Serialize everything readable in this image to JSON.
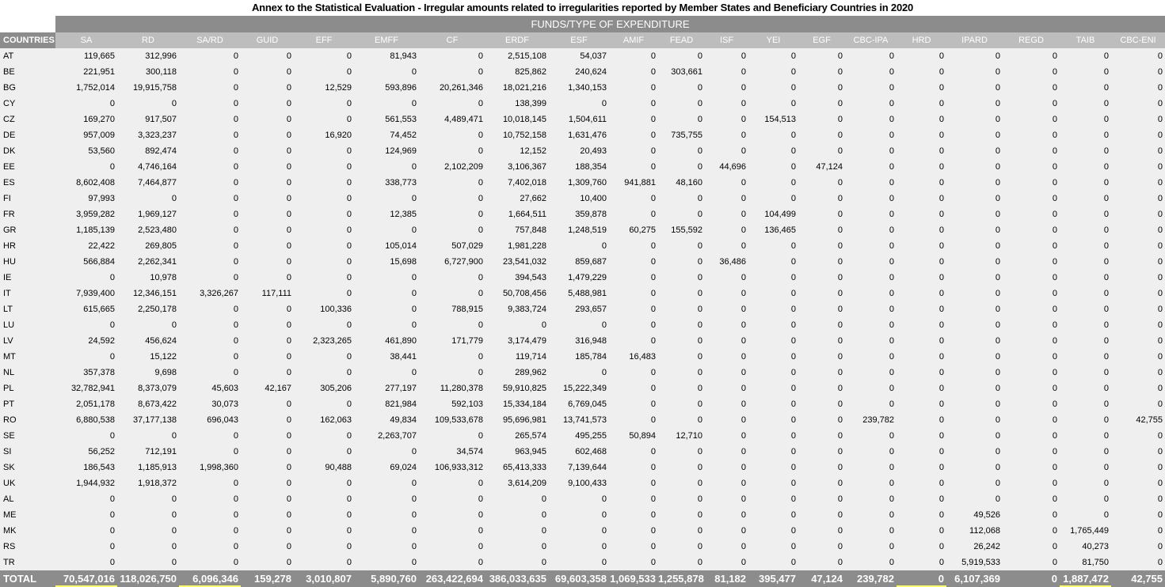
{
  "title": "Annex to the Statistical Evaluation - Irregular amounts related to irregularities reported by Member States and Beneficiary Countries in 2020",
  "table": {
    "group_header": "FUNDS/TYPE OF EXPENDITURE",
    "country_header": "COUNTRIES",
    "columns": [
      "SA",
      "RD",
      "SA/RD",
      "GUID",
      "EFF",
      "EMFF",
      "CF",
      "ERDF",
      "ESF",
      "AMIF",
      "FEAD",
      "ISF",
      "YEI",
      "EGF",
      "CBC-IPA",
      "HRD",
      "IPARD",
      "REGD",
      "TAIB",
      "CBC-ENI"
    ],
    "rows": [
      {
        "country": "AT",
        "values": [
          "119,665",
          "312,996",
          "0",
          "0",
          "0",
          "81,943",
          "0",
          "2,515,108",
          "54,037",
          "0",
          "0",
          "0",
          "0",
          "0",
          "0",
          "0",
          "0",
          "0",
          "0",
          "0"
        ]
      },
      {
        "country": "BE",
        "values": [
          "221,951",
          "300,118",
          "0",
          "0",
          "0",
          "0",
          "0",
          "825,862",
          "240,624",
          "0",
          "303,661",
          "0",
          "0",
          "0",
          "0",
          "0",
          "0",
          "0",
          "0",
          "0"
        ]
      },
      {
        "country": "BG",
        "values": [
          "1,752,014",
          "19,915,758",
          "0",
          "0",
          "12,529",
          "593,896",
          "20,261,346",
          "18,021,216",
          "1,340,153",
          "0",
          "0",
          "0",
          "0",
          "0",
          "0",
          "0",
          "0",
          "0",
          "0",
          "0"
        ]
      },
      {
        "country": "CY",
        "values": [
          "0",
          "0",
          "0",
          "0",
          "0",
          "0",
          "0",
          "138,399",
          "0",
          "0",
          "0",
          "0",
          "0",
          "0",
          "0",
          "0",
          "0",
          "0",
          "0",
          "0"
        ]
      },
      {
        "country": "CZ",
        "values": [
          "169,270",
          "917,507",
          "0",
          "0",
          "0",
          "561,553",
          "4,489,471",
          "10,018,145",
          "1,504,611",
          "0",
          "0",
          "0",
          "154,513",
          "0",
          "0",
          "0",
          "0",
          "0",
          "0",
          "0"
        ]
      },
      {
        "country": "DE",
        "values": [
          "957,009",
          "3,323,237",
          "0",
          "0",
          "16,920",
          "74,452",
          "0",
          "10,752,158",
          "1,631,476",
          "0",
          "735,755",
          "0",
          "0",
          "0",
          "0",
          "0",
          "0",
          "0",
          "0",
          "0"
        ]
      },
      {
        "country": "DK",
        "values": [
          "53,560",
          "892,474",
          "0",
          "0",
          "0",
          "124,969",
          "0",
          "12,152",
          "20,493",
          "0",
          "0",
          "0",
          "0",
          "0",
          "0",
          "0",
          "0",
          "0",
          "0",
          "0"
        ]
      },
      {
        "country": "EE",
        "values": [
          "0",
          "4,746,164",
          "0",
          "0",
          "0",
          "0",
          "2,102,209",
          "3,106,367",
          "188,354",
          "0",
          "0",
          "44,696",
          "0",
          "47,124",
          "0",
          "0",
          "0",
          "0",
          "0",
          "0"
        ]
      },
      {
        "country": "ES",
        "values": [
          "8,602,408",
          "7,464,877",
          "0",
          "0",
          "0",
          "338,773",
          "0",
          "7,402,018",
          "1,309,760",
          "941,881",
          "48,160",
          "0",
          "0",
          "0",
          "0",
          "0",
          "0",
          "0",
          "0",
          "0"
        ]
      },
      {
        "country": "FI",
        "values": [
          "97,993",
          "0",
          "0",
          "0",
          "0",
          "0",
          "0",
          "27,662",
          "10,400",
          "0",
          "0",
          "0",
          "0",
          "0",
          "0",
          "0",
          "0",
          "0",
          "0",
          "0"
        ]
      },
      {
        "country": "FR",
        "values": [
          "3,959,282",
          "1,969,127",
          "0",
          "0",
          "0",
          "12,385",
          "0",
          "1,664,511",
          "359,878",
          "0",
          "0",
          "0",
          "104,499",
          "0",
          "0",
          "0",
          "0",
          "0",
          "0",
          "0"
        ]
      },
      {
        "country": "GR",
        "values": [
          "1,185,139",
          "2,523,480",
          "0",
          "0",
          "0",
          "0",
          "0",
          "757,848",
          "1,248,519",
          "60,275",
          "155,592",
          "0",
          "136,465",
          "0",
          "0",
          "0",
          "0",
          "0",
          "0",
          "0"
        ]
      },
      {
        "country": "HR",
        "values": [
          "22,422",
          "269,805",
          "0",
          "0",
          "0",
          "105,014",
          "507,029",
          "1,981,228",
          "0",
          "0",
          "0",
          "0",
          "0",
          "0",
          "0",
          "0",
          "0",
          "0",
          "0",
          "0"
        ]
      },
      {
        "country": "HU",
        "values": [
          "566,884",
          "2,262,341",
          "0",
          "0",
          "0",
          "15,698",
          "6,727,900",
          "23,541,032",
          "859,687",
          "0",
          "0",
          "36,486",
          "0",
          "0",
          "0",
          "0",
          "0",
          "0",
          "0",
          "0"
        ]
      },
      {
        "country": "IE",
        "values": [
          "0",
          "10,978",
          "0",
          "0",
          "0",
          "0",
          "0",
          "394,543",
          "1,479,229",
          "0",
          "0",
          "0",
          "0",
          "0",
          "0",
          "0",
          "0",
          "0",
          "0",
          "0"
        ]
      },
      {
        "country": "IT",
        "values": [
          "7,939,400",
          "12,346,151",
          "3,326,267",
          "117,111",
          "0",
          "0",
          "0",
          "50,708,456",
          "5,488,981",
          "0",
          "0",
          "0",
          "0",
          "0",
          "0",
          "0",
          "0",
          "0",
          "0",
          "0"
        ]
      },
      {
        "country": "LT",
        "values": [
          "615,665",
          "2,250,178",
          "0",
          "0",
          "100,336",
          "0",
          "788,915",
          "9,383,724",
          "293,657",
          "0",
          "0",
          "0",
          "0",
          "0",
          "0",
          "0",
          "0",
          "0",
          "0",
          "0"
        ]
      },
      {
        "country": "LU",
        "values": [
          "0",
          "0",
          "0",
          "0",
          "0",
          "0",
          "0",
          "0",
          "0",
          "0",
          "0",
          "0",
          "0",
          "0",
          "0",
          "0",
          "0",
          "0",
          "0",
          "0"
        ]
      },
      {
        "country": "LV",
        "values": [
          "24,592",
          "456,624",
          "0",
          "0",
          "2,323,265",
          "461,890",
          "171,779",
          "3,174,479",
          "316,948",
          "0",
          "0",
          "0",
          "0",
          "0",
          "0",
          "0",
          "0",
          "0",
          "0",
          "0"
        ]
      },
      {
        "country": "MT",
        "values": [
          "0",
          "15,122",
          "0",
          "0",
          "0",
          "38,441",
          "0",
          "119,714",
          "185,784",
          "16,483",
          "0",
          "0",
          "0",
          "0",
          "0",
          "0",
          "0",
          "0",
          "0",
          "0"
        ]
      },
      {
        "country": "NL",
        "values": [
          "357,378",
          "9,698",
          "0",
          "0",
          "0",
          "0",
          "0",
          "289,962",
          "0",
          "0",
          "0",
          "0",
          "0",
          "0",
          "0",
          "0",
          "0",
          "0",
          "0",
          "0"
        ]
      },
      {
        "country": "PL",
        "values": [
          "32,782,941",
          "8,373,079",
          "45,603",
          "42,167",
          "305,206",
          "277,197",
          "11,280,378",
          "59,910,825",
          "15,222,349",
          "0",
          "0",
          "0",
          "0",
          "0",
          "0",
          "0",
          "0",
          "0",
          "0",
          "0"
        ]
      },
      {
        "country": "PT",
        "values": [
          "2,051,178",
          "8,673,422",
          "30,073",
          "0",
          "0",
          "821,984",
          "592,103",
          "15,334,184",
          "6,769,045",
          "0",
          "0",
          "0",
          "0",
          "0",
          "0",
          "0",
          "0",
          "0",
          "0",
          "0"
        ]
      },
      {
        "country": "RO",
        "values": [
          "6,880,538",
          "37,177,138",
          "696,043",
          "0",
          "162,063",
          "49,834",
          "109,533,678",
          "95,696,981",
          "13,741,573",
          "0",
          "0",
          "0",
          "0",
          "0",
          "239,782",
          "0",
          "0",
          "0",
          "0",
          "42,755"
        ]
      },
      {
        "country": "SE",
        "values": [
          "0",
          "0",
          "0",
          "0",
          "0",
          "2,263,707",
          "0",
          "265,574",
          "495,255",
          "50,894",
          "12,710",
          "0",
          "0",
          "0",
          "0",
          "0",
          "0",
          "0",
          "0",
          "0"
        ]
      },
      {
        "country": "SI",
        "values": [
          "56,252",
          "712,191",
          "0",
          "0",
          "0",
          "0",
          "34,574",
          "963,945",
          "602,468",
          "0",
          "0",
          "0",
          "0",
          "0",
          "0",
          "0",
          "0",
          "0",
          "0",
          "0"
        ]
      },
      {
        "country": "SK",
        "values": [
          "186,543",
          "1,185,913",
          "1,998,360",
          "0",
          "90,488",
          "69,024",
          "106,933,312",
          "65,413,333",
          "7,139,644",
          "0",
          "0",
          "0",
          "0",
          "0",
          "0",
          "0",
          "0",
          "0",
          "0",
          "0"
        ]
      },
      {
        "country": "UK",
        "values": [
          "1,944,932",
          "1,918,372",
          "0",
          "0",
          "0",
          "0",
          "0",
          "3,614,209",
          "9,100,433",
          "0",
          "0",
          "0",
          "0",
          "0",
          "0",
          "0",
          "0",
          "0",
          "0",
          "0"
        ]
      },
      {
        "country": "AL",
        "values": [
          "0",
          "0",
          "0",
          "0",
          "0",
          "0",
          "0",
          "0",
          "0",
          "0",
          "0",
          "0",
          "0",
          "0",
          "0",
          "0",
          "0",
          "0",
          "0",
          "0"
        ]
      },
      {
        "country": "ME",
        "values": [
          "0",
          "0",
          "0",
          "0",
          "0",
          "0",
          "0",
          "0",
          "0",
          "0",
          "0",
          "0",
          "0",
          "0",
          "0",
          "0",
          "49,526",
          "0",
          "0",
          "0"
        ]
      },
      {
        "country": "MK",
        "values": [
          "0",
          "0",
          "0",
          "0",
          "0",
          "0",
          "0",
          "0",
          "0",
          "0",
          "0",
          "0",
          "0",
          "0",
          "0",
          "0",
          "112,068",
          "0",
          "1,765,449",
          "0"
        ]
      },
      {
        "country": "RS",
        "values": [
          "0",
          "0",
          "0",
          "0",
          "0",
          "0",
          "0",
          "0",
          "0",
          "0",
          "0",
          "0",
          "0",
          "0",
          "0",
          "0",
          "26,242",
          "0",
          "40,273",
          "0"
        ]
      },
      {
        "country": "TR",
        "values": [
          "0",
          "0",
          "0",
          "0",
          "0",
          "0",
          "0",
          "0",
          "0",
          "0",
          "0",
          "0",
          "0",
          "0",
          "0",
          "0",
          "5,919,533",
          "0",
          "81,750",
          "0"
        ]
      }
    ],
    "total": {
      "label": "TOTAL",
      "values": [
        "70,547,016",
        "118,026,750",
        "6,096,346",
        "159,278",
        "3,010,807",
        "5,890,760",
        "263,422,694",
        "386,033,635",
        "69,603,358",
        "1,069,533",
        "1,255,878",
        "81,182",
        "395,477",
        "47,124",
        "239,782",
        "0",
        "6,107,369",
        "0",
        "1,887,472",
        "42,755"
      ]
    }
  },
  "colors": {
    "header_dark": "#8c8c8c",
    "header_light": "#bdbdbd",
    "cell_bg": "#efefef",
    "underline": "#ffff66"
  }
}
